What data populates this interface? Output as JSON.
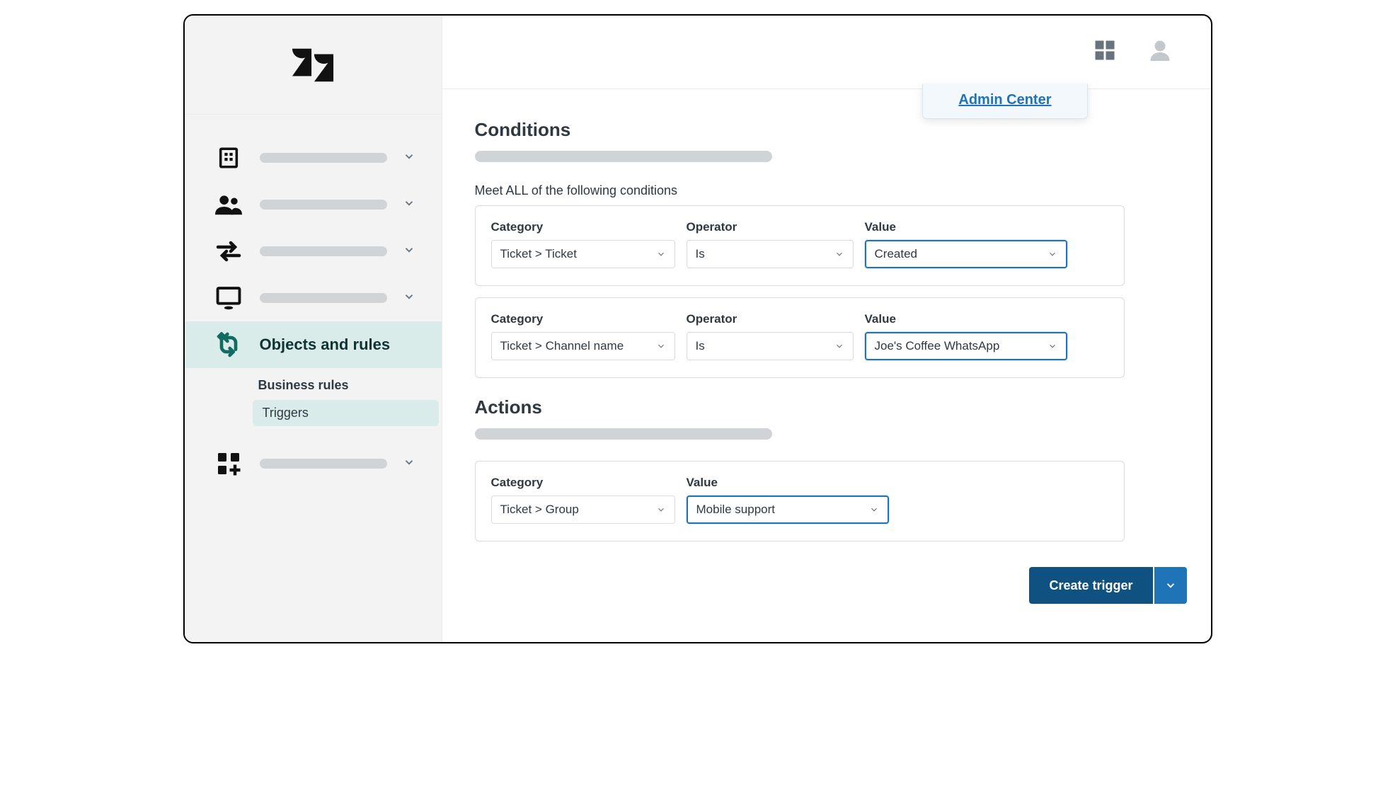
{
  "header": {
    "admin_center_label": "Admin Center"
  },
  "sidebar": {
    "objects_and_rules_label": "Objects and rules",
    "business_rules_label": "Business rules",
    "triggers_label": "Triggers"
  },
  "conditions": {
    "heading": "Conditions",
    "meet_all_label": "Meet ALL of the following conditions",
    "labels": {
      "category": "Category",
      "operator": "Operator",
      "value": "Value"
    },
    "rows": [
      {
        "category": "Ticket > Ticket",
        "operator": "Is",
        "value": "Created"
      },
      {
        "category": "Ticket > Channel name",
        "operator": "Is",
        "value": "Joe's Coffee WhatsApp"
      }
    ]
  },
  "actions": {
    "heading": "Actions",
    "labels": {
      "category": "Category",
      "value": "Value"
    },
    "rows": [
      {
        "category": "Ticket > Group",
        "value": "Mobile support"
      }
    ]
  },
  "footer": {
    "create_label": "Create trigger"
  }
}
